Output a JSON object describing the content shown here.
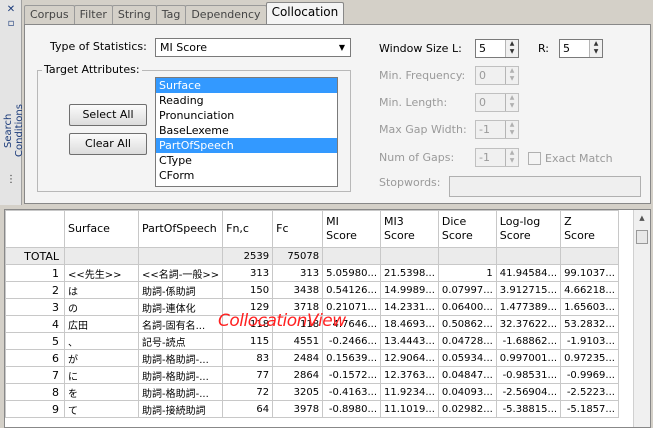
{
  "sidebar": {
    "close_glyph": "✕",
    "pin_glyph": "▫",
    "title": "Search Conditions",
    "more_glyph": "⋮"
  },
  "tabs": [
    "Corpus",
    "Filter",
    "String",
    "Tag",
    "Dependency",
    "Collocation"
  ],
  "collocation": {
    "stat_label": "Type of Statistics:",
    "stat_value": "MI Score",
    "target_label": "Target Attributes:",
    "select_all": "Select All",
    "clear_all": "Clear All",
    "attributes": [
      "Surface",
      "Reading",
      "Pronunciation",
      "BaseLexeme",
      "PartOfSpeech",
      "CType",
      "CForm"
    ],
    "selected_attributes": [
      "Surface",
      "PartOfSpeech"
    ],
    "window_label": "Window Size L:",
    "window_l": "5",
    "r_label": "R:",
    "window_r": "5",
    "min_freq_label": "Min. Frequency:",
    "min_freq": "0",
    "min_len_label": "Min. Length:",
    "min_len": "0",
    "max_gap_label": "Max Gap Width:",
    "max_gap": "-1",
    "num_gaps_label": "Num of Gaps:",
    "num_gaps": "-1",
    "exact_match_label": "Exact Match",
    "exact_match": false,
    "stopwords_label": "Stopwords:",
    "stopwords": ""
  },
  "table": {
    "headers": [
      "",
      "Surface",
      "PartOfSpeech",
      "Fn,c",
      "Fc",
      "MI\nScore",
      "MI3\nScore",
      "Dice\nScore",
      "Log-log\nScore",
      "Z\nScore"
    ],
    "total_row": [
      "TOTAL",
      "",
      "",
      "2539",
      "75078",
      "",
      "",
      "",
      "",
      ""
    ],
    "rows": [
      [
        "1",
        "<<先生>>",
        "<<名詞-一般>>",
        "313",
        "313",
        "5.05980...",
        "21.5398...",
        "1",
        "41.94584...",
        "99.1037..."
      ],
      [
        "2",
        "は",
        "助詞-係助詞",
        "150",
        "3438",
        "0.54126...",
        "14.9989...",
        "0.07997...",
        "3.912715...",
        "4.66218..."
      ],
      [
        "3",
        "の",
        "助詞-連体化",
        "129",
        "3718",
        "0.21071...",
        "14.2331...",
        "0.06400...",
        "1.477389...",
        "1.65603..."
      ],
      [
        "4",
        "広田",
        "名詞-固有名...",
        "118",
        "118",
        "4.7646...",
        "18.4693...",
        "0.50862...",
        "32.37622...",
        "53.2832..."
      ],
      [
        "5",
        "、",
        "記号-読点",
        "115",
        "4551",
        "-0.2466...",
        "13.4443...",
        "0.04728...",
        "-1.68862...",
        "-1.9103..."
      ],
      [
        "6",
        "が",
        "助詞-格助詞-...",
        "83",
        "2484",
        "0.15639...",
        "12.9064...",
        "0.05934...",
        "0.997001...",
        "0.97235..."
      ],
      [
        "7",
        "に",
        "助詞-格助詞-...",
        "77",
        "2864",
        "-0.1572...",
        "12.3763...",
        "0.04847...",
        "-0.98531...",
        "-0.9969..."
      ],
      [
        "8",
        "を",
        "助詞-格助詞-...",
        "72",
        "3205",
        "-0.4163...",
        "11.9234...",
        "0.04093...",
        "-2.56904...",
        "-2.5223..."
      ],
      [
        "9",
        "て",
        "助詞-接続助詞",
        "64",
        "3978",
        "-0.8980...",
        "11.1019...",
        "0.02982...",
        "-5.38815...",
        "-5.1857..."
      ]
    ]
  },
  "watermark": "CollocationView"
}
